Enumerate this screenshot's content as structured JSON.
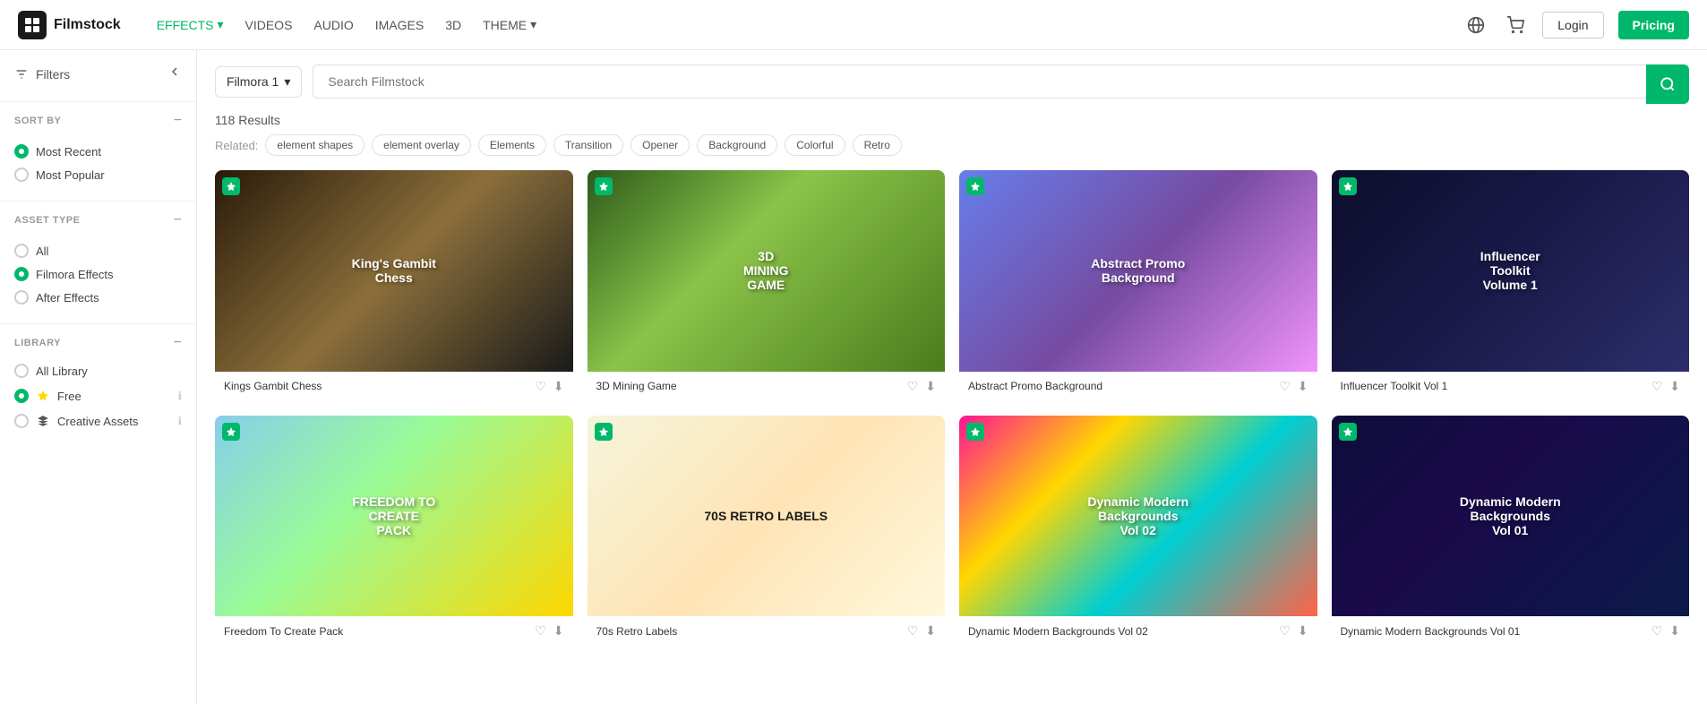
{
  "topnav": {
    "logo_text": "Filmstock",
    "nav_items": [
      {
        "label": "EFFECTS",
        "active": true,
        "has_arrow": true
      },
      {
        "label": "VIDEOS",
        "active": false
      },
      {
        "label": "AUDIO",
        "active": false
      },
      {
        "label": "IMAGES",
        "active": false
      },
      {
        "label": "3D",
        "active": false
      },
      {
        "label": "THEME",
        "active": false,
        "has_arrow": true
      }
    ],
    "login_label": "Login",
    "pricing_label": "Pricing"
  },
  "sidebar": {
    "filters_label": "Filters",
    "sort_by": {
      "title": "SORT BY",
      "options": [
        {
          "label": "Most Recent",
          "selected": true
        },
        {
          "label": "Most Popular",
          "selected": false
        }
      ]
    },
    "asset_type": {
      "title": "ASSET TYPE",
      "options": [
        {
          "label": "All",
          "selected": false
        },
        {
          "label": "Filmora Effects",
          "selected": true
        },
        {
          "label": "After Effects",
          "selected": false
        }
      ]
    },
    "library": {
      "title": "LIBRARY",
      "items": [
        {
          "label": "All Library",
          "type": "radio",
          "selected": false
        },
        {
          "label": "Free",
          "type": "special",
          "selected": true,
          "has_info": true
        },
        {
          "label": "Creative Assets",
          "type": "special",
          "selected": false,
          "has_info": true
        }
      ]
    }
  },
  "search": {
    "selector_label": "Filmora 1",
    "placeholder": "Search Filmstock"
  },
  "results": {
    "count": "118 Results",
    "related_label": "Related:",
    "tags": [
      "element shapes",
      "element overlay",
      "Elements",
      "Transition",
      "Opener",
      "Background",
      "Colorful",
      "Retro"
    ]
  },
  "assets": [
    {
      "id": 1,
      "name": "Kings Gambit Chess",
      "thumb_class": "thumb-kings",
      "thumb_label": "King's Gambit Chess"
    },
    {
      "id": 2,
      "name": "3D Mining Game",
      "thumb_class": "thumb-mining",
      "thumb_label": "3D MINING GAME"
    },
    {
      "id": 3,
      "name": "Abstract Promo Background",
      "thumb_class": "thumb-abstract",
      "thumb_label": "Abstract Promo Background"
    },
    {
      "id": 4,
      "name": "Influencer Toolkit Vol 1",
      "thumb_class": "thumb-influencer",
      "thumb_label": "Influencer Toolkit Volume 1"
    },
    {
      "id": 5,
      "name": "Freedom To Create Pack",
      "thumb_class": "thumb-freedom",
      "thumb_label": "FREEDOM TO CREATE PACK"
    },
    {
      "id": 6,
      "name": "70s Retro Labels",
      "thumb_class": "thumb-retro",
      "thumb_label": "70S RETRO LABELS",
      "label_dark": true
    },
    {
      "id": 7,
      "name": "Dynamic Modern Backgrounds Vol 02",
      "thumb_class": "thumb-dynamic2",
      "thumb_label": "Dynamic Modern Backgrounds Vol 02"
    },
    {
      "id": 8,
      "name": "Dynamic Modern Backgrounds Vol 01",
      "thumb_class": "thumb-dynamic1",
      "thumb_label": "Dynamic Modern Backgrounds Vol 01"
    }
  ]
}
